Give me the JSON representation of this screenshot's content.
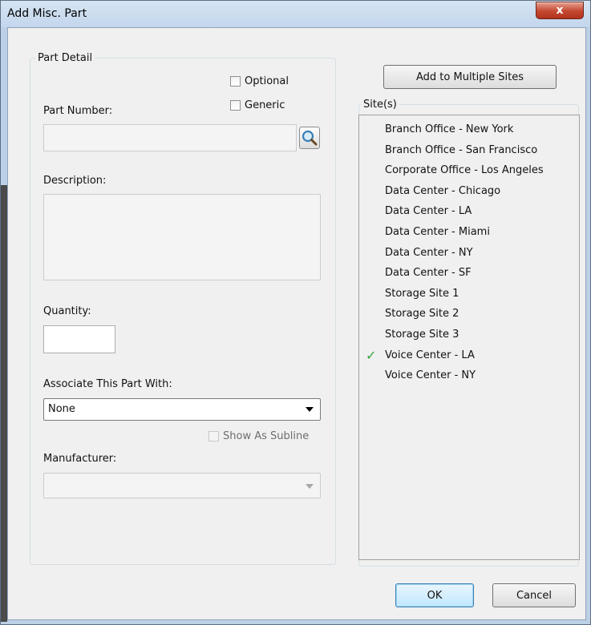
{
  "window": {
    "title": "Add Misc. Part",
    "close_label": "x"
  },
  "part_detail": {
    "group_title": "Part Detail",
    "optional_label": "Optional",
    "generic_label": "Generic",
    "part_number_label": "Part Number:",
    "part_number_value": "",
    "description_label": "Description:",
    "description_value": "",
    "quantity_label": "Quantity:",
    "quantity_value": "",
    "associate_label": "Associate This Part With:",
    "associate_value": "None",
    "show_as_subline_label": "Show As Subline",
    "manufacturer_label": "Manufacturer:",
    "manufacturer_value": ""
  },
  "sites": {
    "add_multiple_label": "Add to Multiple Sites",
    "group_title": "Site(s)",
    "items": [
      {
        "label": "Branch Office - New York",
        "checked": false
      },
      {
        "label": "Branch Office - San Francisco",
        "checked": false
      },
      {
        "label": "Corporate Office - Los Angeles",
        "checked": false
      },
      {
        "label": "Data Center - Chicago",
        "checked": false
      },
      {
        "label": "Data Center - LA",
        "checked": false
      },
      {
        "label": "Data Center - Miami",
        "checked": false
      },
      {
        "label": "Data Center - NY",
        "checked": false
      },
      {
        "label": "Data Center - SF",
        "checked": false
      },
      {
        "label": "Storage Site 1",
        "checked": false
      },
      {
        "label": "Storage Site 2",
        "checked": false
      },
      {
        "label": "Storage Site 3",
        "checked": false
      },
      {
        "label": "Voice Center - LA",
        "checked": true
      },
      {
        "label": "Voice Center - NY",
        "checked": false
      }
    ],
    "check_glyph": "✓"
  },
  "footer": {
    "ok_label": "OK",
    "cancel_label": "Cancel"
  },
  "colors": {
    "check_green": "#3aa53a",
    "title_bar": "#c3d6ec",
    "close_red": "#c4472f"
  }
}
